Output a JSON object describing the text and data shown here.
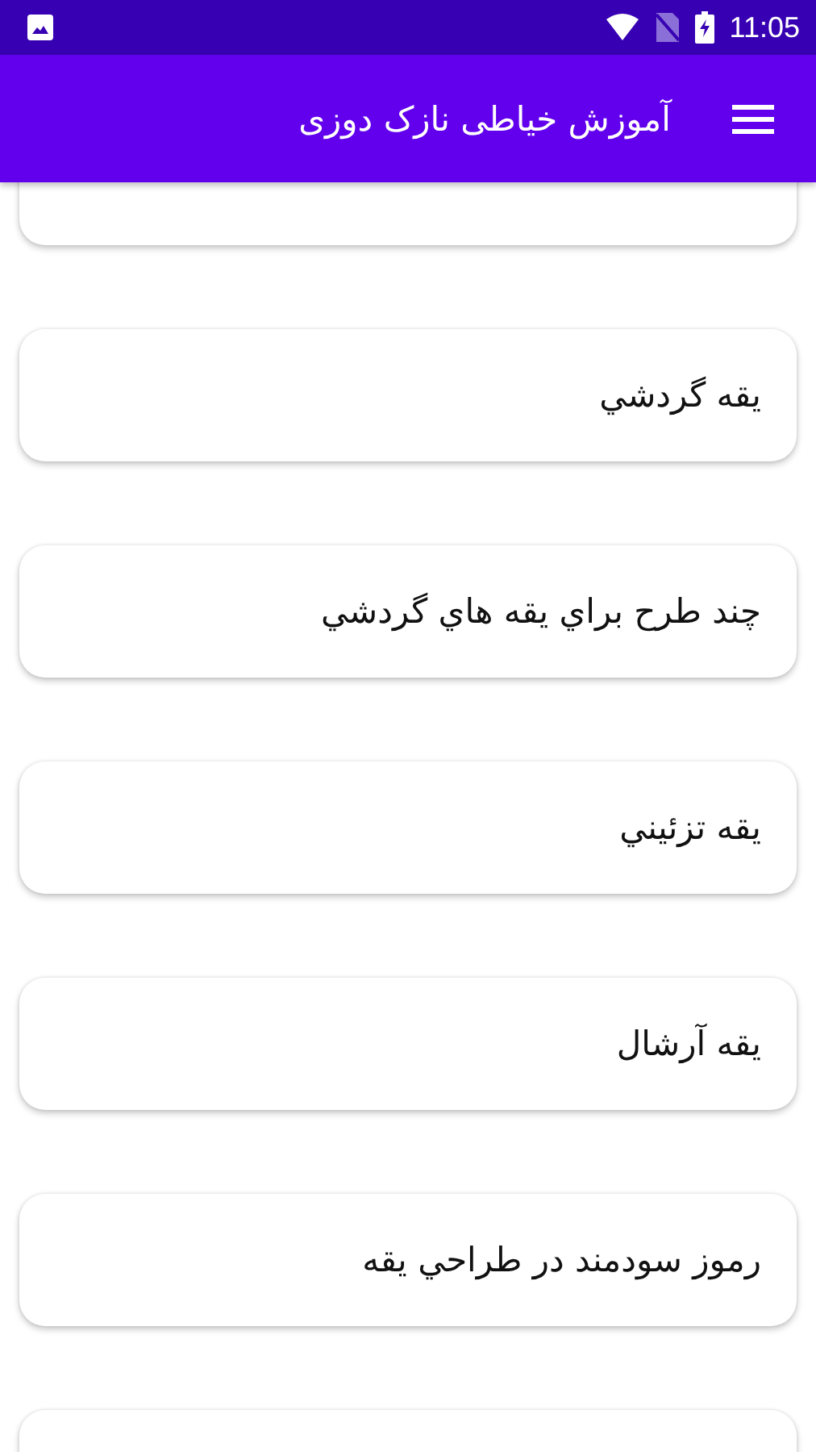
{
  "status_bar": {
    "time": "11:05"
  },
  "app_bar": {
    "title": "آموزش خیاطی نازک دوزی"
  },
  "items": [
    {
      "kind": "partial"
    },
    {
      "kind": "card",
      "title": "يقه گردشي"
    },
    {
      "kind": "card",
      "title": "چند طرح براي يقه هاي گردشي"
    },
    {
      "kind": "card",
      "title": "يقه تزئيني"
    },
    {
      "kind": "card",
      "title": "يقه آرشال"
    },
    {
      "kind": "card",
      "title": "رموز سودمند در طراحي يقه"
    },
    {
      "kind": "partial"
    }
  ]
}
